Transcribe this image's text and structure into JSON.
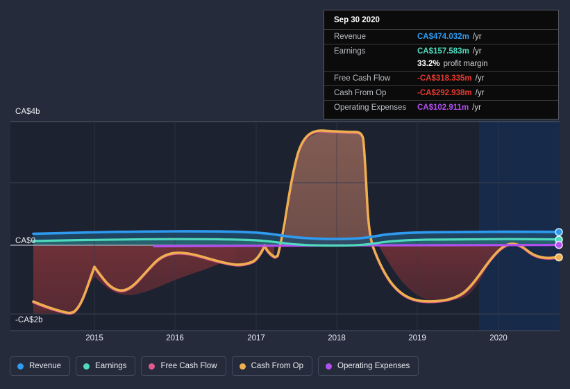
{
  "tooltip": {
    "date": "Sep 30 2020",
    "rows": [
      {
        "label": "Revenue",
        "value": "CA$474.032m",
        "unit": "/yr",
        "color": "#2e9bf0"
      },
      {
        "label": "Earnings",
        "value": "CA$157.583m",
        "unit": "/yr",
        "color": "#4fd9bd"
      },
      {
        "label": "",
        "value": "33.2%",
        "unit": "profit margin",
        "color": "#ffffff",
        "sub": true
      },
      {
        "label": "Free Cash Flow",
        "value": "-CA$318.335m",
        "unit": "/yr",
        "color": "#e8392f"
      },
      {
        "label": "Cash From Op",
        "value": "-CA$292.938m",
        "unit": "/yr",
        "color": "#e8392f"
      },
      {
        "label": "Operating Expenses",
        "value": "CA$102.911m",
        "unit": "/yr",
        "color": "#b14ff0"
      }
    ]
  },
  "legend": {
    "items": [
      {
        "label": "Revenue",
        "color": "#2e9bf0"
      },
      {
        "label": "Earnings",
        "color": "#4fd9bd"
      },
      {
        "label": "Free Cash Flow",
        "color": "#e05a8f"
      },
      {
        "label": "Cash From Op",
        "color": "#eeb04e"
      },
      {
        "label": "Operating Expenses",
        "color": "#b14ff0"
      }
    ]
  },
  "axes": {
    "y_labels": [
      "CA$4b",
      "CA$0",
      "-CA$2b"
    ],
    "x_labels": [
      "2015",
      "2016",
      "2017",
      "2018",
      "2019",
      "2020"
    ]
  },
  "chart_data": {
    "type": "area",
    "title": "",
    "xlabel": "",
    "ylabel": "CA$",
    "ylim": [
      -2.2,
      4.0
    ],
    "yticks": [
      4,
      2,
      0,
      -2
    ],
    "ytick_labels": [
      "CA$4b",
      "",
      "CA$0",
      "-CA$2b"
    ],
    "x": [
      "2014.4",
      "2014.6",
      "2014.8",
      "2015.0",
      "2015.2",
      "2015.4",
      "2015.6",
      "2015.8",
      "2016.0",
      "2016.2",
      "2016.4",
      "2016.6",
      "2016.8",
      "2017.0",
      "2017.2",
      "2017.4",
      "2017.6",
      "2017.8",
      "2018.0",
      "2018.2",
      "2018.4",
      "2018.6",
      "2018.8",
      "2019.0",
      "2019.2",
      "2019.4",
      "2019.6",
      "2019.8",
      "2020.0",
      "2020.2",
      "2020.4",
      "2020.75"
    ],
    "xticks": [
      "2015",
      "2016",
      "2017",
      "2018",
      "2019",
      "2020"
    ],
    "grid": true,
    "legend_position": "bottom",
    "forecast_band": {
      "start": "2019.95",
      "end": "2020.75",
      "label": "analyst estimates region"
    },
    "series": [
      {
        "name": "Revenue",
        "color": "#2e9bf0",
        "units": "CA$b",
        "values": [
          0.4,
          0.41,
          0.42,
          0.43,
          0.44,
          0.45,
          0.46,
          0.47,
          0.47,
          0.46,
          0.45,
          0.45,
          0.44,
          0.43,
          0.42,
          0.35,
          0.3,
          0.28,
          0.27,
          0.27,
          0.28,
          0.34,
          0.4,
          0.41,
          0.42,
          0.42,
          0.43,
          0.44,
          0.45,
          0.46,
          0.47,
          0.474
        ]
      },
      {
        "name": "Earnings",
        "color": "#4fd9bd",
        "units": "CA$b",
        "values": [
          0.13,
          0.13,
          0.14,
          0.14,
          0.15,
          0.16,
          0.17,
          0.18,
          0.18,
          0.17,
          0.16,
          0.16,
          0.15,
          0.14,
          0.12,
          0.08,
          0.04,
          0.02,
          0.01,
          0.01,
          0.02,
          0.06,
          0.11,
          0.13,
          0.14,
          0.14,
          0.15,
          0.15,
          0.16,
          0.16,
          0.16,
          0.158
        ]
      },
      {
        "name": "Free Cash Flow",
        "color": "#e05a8f",
        "units": "CA$b",
        "values": [
          -1.76,
          -1.88,
          -2.0,
          -2.06,
          -1.7,
          -1.2,
          -1.05,
          -1.22,
          -1.38,
          -1.2,
          -0.9,
          -0.62,
          -0.42,
          -0.36,
          -0.34,
          -0.3,
          -0.6,
          1.2,
          2.9,
          3.35,
          3.5,
          3.52,
          1.6,
          -0.4,
          -1.05,
          -1.45,
          -1.7,
          -1.72,
          -1.2,
          -0.25,
          0.02,
          -0.318
        ]
      },
      {
        "name": "Cash From Op",
        "color": "#eeb04e",
        "units": "CA$b",
        "values": [
          -1.75,
          -1.87,
          -1.99,
          -2.05,
          -1.68,
          -1.18,
          -1.03,
          -1.2,
          -1.36,
          -1.18,
          -0.88,
          -0.6,
          -0.4,
          -0.34,
          -0.32,
          -0.28,
          -0.58,
          1.22,
          2.92,
          3.37,
          3.52,
          3.54,
          1.62,
          -0.38,
          -1.03,
          -1.43,
          -1.68,
          -1.7,
          -1.18,
          -0.22,
          0.05,
          -0.293
        ]
      },
      {
        "name": "Operating Expenses",
        "color": "#b14ff0",
        "units": "CA$b",
        "starts_at": "2015.55",
        "values": [
          null,
          null,
          null,
          null,
          null,
          null,
          0.035,
          0.04,
          0.045,
          0.05,
          0.05,
          0.055,
          0.06,
          0.06,
          0.065,
          0.07,
          0.07,
          0.075,
          0.08,
          0.08,
          0.08,
          0.085,
          0.085,
          0.09,
          0.09,
          0.09,
          0.095,
          0.095,
          0.1,
          0.1,
          0.1,
          0.103
        ]
      }
    ]
  }
}
